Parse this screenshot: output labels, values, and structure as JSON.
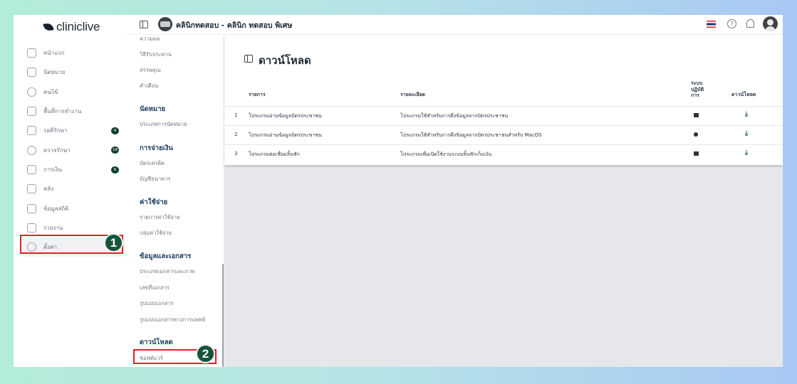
{
  "app": {
    "logo_text": "cliniclive"
  },
  "header": {
    "clinic_name": "คลินิกทดสอบ - คลินิก ทดสอบ พิเศษ"
  },
  "sidebar": {
    "items": [
      {
        "label": "หน้าแรก",
        "icon": "home-icon"
      },
      {
        "label": "นัดหมาย",
        "icon": "calendar-icon"
      },
      {
        "label": "คนไข้",
        "icon": "person-icon"
      },
      {
        "label": "พื้นที่การทำงาน",
        "icon": "workspace-icon"
      },
      {
        "label": "รอตีรักษา",
        "icon": "sofa-icon",
        "badge": "4"
      },
      {
        "label": "ตรวจรักษา",
        "icon": "stethoscope-icon",
        "badge": "18"
      },
      {
        "label": "การเงิน",
        "icon": "money-icon",
        "badge": "6"
      },
      {
        "label": "คลัง",
        "icon": "box-icon"
      },
      {
        "label": "ข้อมูลสถิติ",
        "icon": "stats-icon"
      },
      {
        "label": "รายงาน",
        "icon": "report-icon"
      },
      {
        "label": "ตั้งค่า",
        "icon": "gear-icon"
      }
    ]
  },
  "steps": {
    "one": "1",
    "two": "2"
  },
  "submenu": {
    "items_top": [
      "ความแพ",
      "วิธีรับประทาน",
      "สรรพคุณ",
      "คำเตือน"
    ],
    "sections": [
      {
        "heading": "นัดหมาย",
        "items": [
          "ประเภทการนัดหมาย"
        ]
      },
      {
        "heading": "การจ่ายเงิน",
        "items": [
          "บัตรเครดิต",
          "บัญชีธนาคาร"
        ]
      },
      {
        "heading": "ค่าใช้จ่าย",
        "items": [
          "รายการค่าใช้จ่าย",
          "กลุ่มค่าใช้จ่าย"
        ]
      },
      {
        "heading": "ข้อมูลและเอกสาร",
        "items": [
          "ประเภทเอกสารและภาพ",
          "เลขที่เอกสาร",
          "รูปแบบเอกสาร",
          "รูปแบบเอกสารทางการแพทย์"
        ]
      },
      {
        "heading": "ดาวน์โหลด",
        "items": [
          "ซอฟต์แวร์"
        ]
      }
    ]
  },
  "page": {
    "title": "ดาวน์โหลด",
    "columns": {
      "item": "รายการ",
      "detail": "รายละเอียด",
      "os": "ระบบ\nปฏิบัติ\nการ",
      "download": "ดาวน์โหลด"
    },
    "rows": [
      {
        "no": "1",
        "item": "โปรแกรมอ่านข้อมูลบัตรประชาชน",
        "detail": "โปรแกรมใช้สำหรับการดึงข้อมูลจากบัตรประชาชน",
        "os": "windows"
      },
      {
        "no": "2",
        "item": "โปรแกรมอ่านข้อมูลบัตรประชาชน",
        "detail": "โปรแกรมใช้สำหรับการดึงข้อมูลจากบัตรประชาชนสำหรับ MacOS",
        "os": "macos"
      },
      {
        "no": "3",
        "item": "โปรแกรมต่อเชื่อมลิ้นชัก",
        "detail": "โปรแกรมเพื่อเปิดใช้งานระบบลิ้นชักเก็บเงิน",
        "os": "windows"
      }
    ]
  },
  "colors": {
    "accent": "#15543b",
    "highlight": "#e42027",
    "heading": "#1b3a5e"
  }
}
